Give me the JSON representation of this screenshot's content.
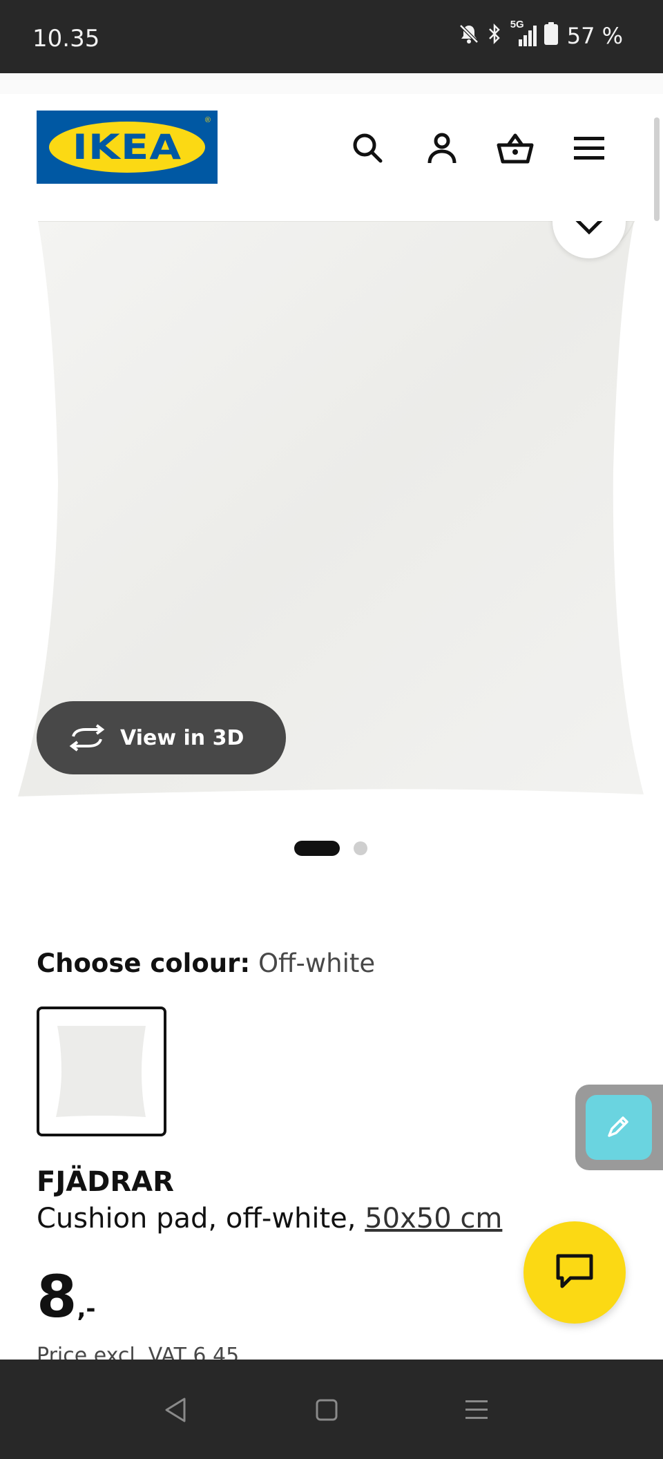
{
  "status_bar": {
    "time": "10.35",
    "network": "5G",
    "battery": "57 %",
    "icons": [
      "mute-icon",
      "bluetooth-icon",
      "signal-icon",
      "battery-icon"
    ]
  },
  "header": {
    "logo_text": "IKEA",
    "actions": [
      "search-icon",
      "account-icon",
      "basket-icon",
      "menu-icon"
    ]
  },
  "gallery": {
    "view_3d_label": "View in 3D",
    "slide_count": 2,
    "active_slide": 1
  },
  "product": {
    "colour_label": "Choose colour:",
    "colour_value": "Off-white",
    "name": "FJÄDRAR",
    "description": "Cushion pad, off-white,",
    "size_link": "50x50 cm",
    "price_main": "8",
    "price_suffix": ",-",
    "price_excl_vat": "Price excl. VAT 6.45"
  },
  "colors": {
    "brand_blue": "#0058a3",
    "brand_yellow": "#fbd914",
    "dark_bar": "#282828",
    "tool_accent": "#6ad4e0"
  }
}
